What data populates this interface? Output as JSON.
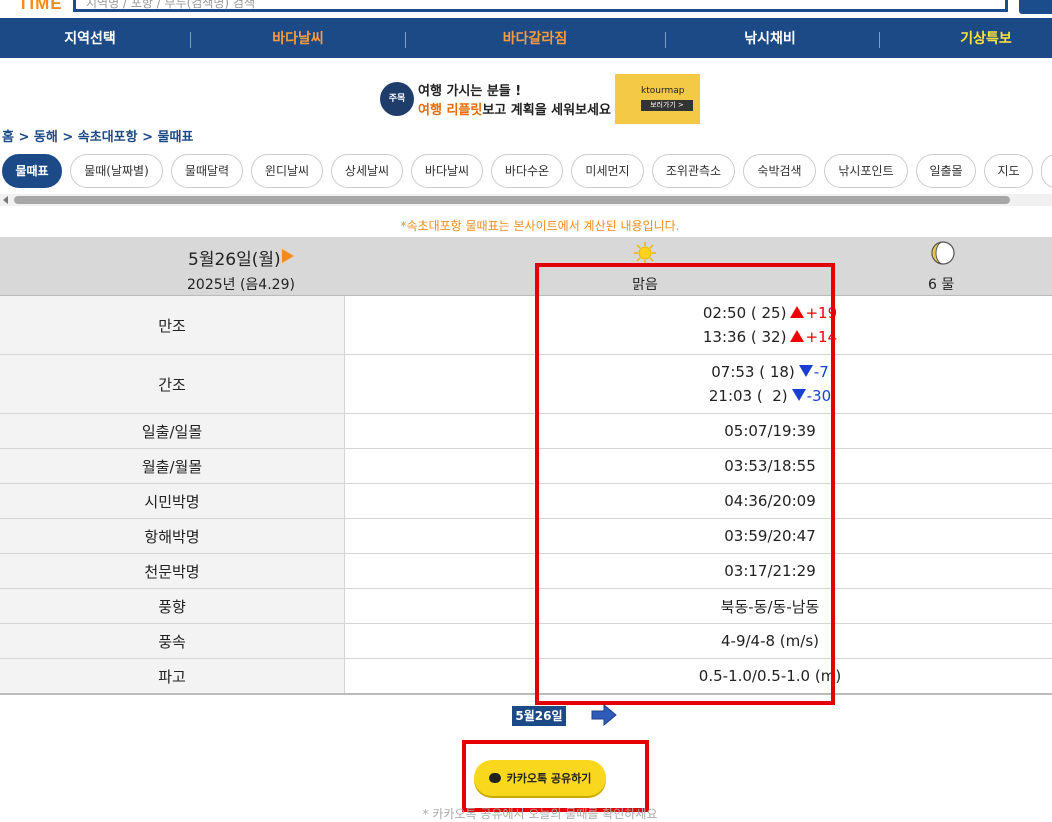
{
  "header": {
    "logo_text": "TIME",
    "search_placeholder": "지역명 / 포항 / 부두(검색명) 검색"
  },
  "nav": [
    {
      "label": "지역선택",
      "color": "#ffffff"
    },
    {
      "label": "바다날씨",
      "color": "#ff9a3c"
    },
    {
      "label": "바다갈라짐",
      "color": "#ff9a3c"
    },
    {
      "label": "낚시채비",
      "color": "#ffffff"
    },
    {
      "label": "기상특보",
      "color": "#ffe23a"
    }
  ],
  "banner": {
    "badge": "주목",
    "line1": "여행 가시는 분들 !",
    "line2_highlight": "여행 리플릿",
    "line2_rest": "보고 계획을 세워보세요",
    "brand": "ktourmap",
    "button": "보러가기 >"
  },
  "breadcrumb": "홈 > 동해 > 속초대포항 > 물때표",
  "tabs": [
    {
      "label": "물때표",
      "active": true
    },
    {
      "label": "물때(날짜별)"
    },
    {
      "label": "물때달력"
    },
    {
      "label": "윈디날씨"
    },
    {
      "label": "상세날씨"
    },
    {
      "label": "바다날씨"
    },
    {
      "label": "바다수온"
    },
    {
      "label": "미세먼지"
    },
    {
      "label": "조위관측소"
    },
    {
      "label": "숙박검색"
    },
    {
      "label": "낚시포인트"
    },
    {
      "label": "일출몰"
    },
    {
      "label": "지도"
    }
  ],
  "notice": "*속초대포항 물때표는 본사이트에서 계산된 내용입니다.",
  "day": {
    "date": "5월26일(월)",
    "year_lunar": "2025년 (음4.29)",
    "weather": "맑음",
    "tide_name": "6 물"
  },
  "rows": {
    "high_tide": {
      "label": "만조",
      "entries": [
        {
          "time": "02:50 ( 25)",
          "change": "+19"
        },
        {
          "time": "13:36 ( 32)",
          "change": "+14"
        }
      ]
    },
    "low_tide": {
      "label": "간조",
      "entries": [
        {
          "time": "07:53 ( 18)",
          "change": "-7"
        },
        {
          "time": "21:03 (  2)",
          "change": "-30"
        }
      ]
    },
    "sun": {
      "label": "일출/일몰",
      "value": "05:07/19:39"
    },
    "moon": {
      "label": "월출/월몰",
      "value": "03:53/18:55"
    },
    "civil": {
      "label": "시민박명",
      "value": "04:36/20:09"
    },
    "nautical": {
      "label": "항해박명",
      "value": "03:59/20:47"
    },
    "astro": {
      "label": "천문박명",
      "value": "03:17/21:29"
    },
    "wind_dir": {
      "label": "풍향",
      "value": "북동-동/동-남동"
    },
    "wind_speed": {
      "label": "풍속",
      "value": "4-9/4-8 (m/s)"
    },
    "wave": {
      "label": "파고",
      "value": "0.5-1.0/0.5-1.0 (m)"
    }
  },
  "footer": {
    "date_chip": "5월26일",
    "kakao_button": "카카오톡 공유하기",
    "note": "* 카카오톡 공유에서 오늘의 물때를 확인하세요"
  },
  "colors": {
    "primary_blue": "#1c4a86",
    "accent_orange": "#f28c1e",
    "highlight_red": "#e50000",
    "kakao_yellow": "#f9d71c"
  }
}
